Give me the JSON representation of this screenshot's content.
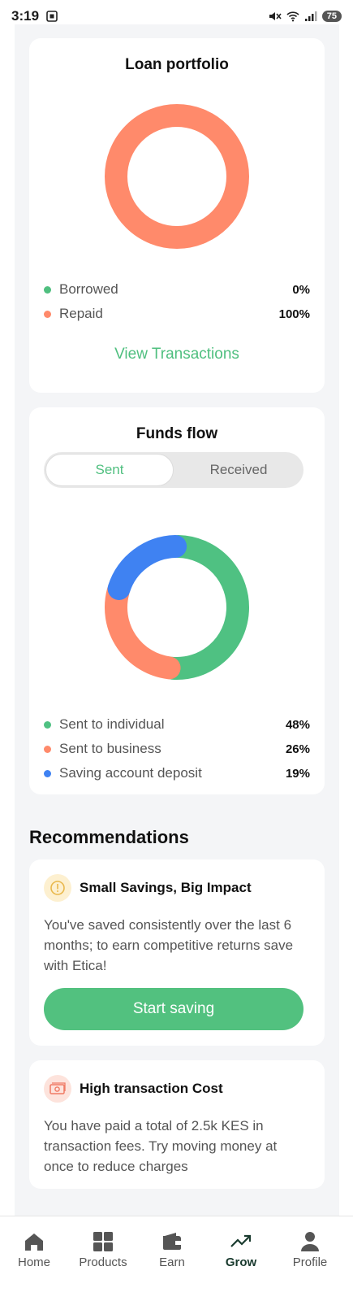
{
  "status_bar": {
    "time": "3:19",
    "battery": "75"
  },
  "loan_portfolio": {
    "title": "Loan portfolio",
    "legend": [
      {
        "label": "Borrowed",
        "value": "0%",
        "color": "#4fbf7f"
      },
      {
        "label": "Repaid",
        "value": "100%",
        "color": "#ff8a6b"
      }
    ],
    "link": "View Transactions"
  },
  "funds_flow": {
    "title": "Funds flow",
    "tabs": {
      "sent": "Sent",
      "received": "Received"
    },
    "legend": [
      {
        "label": "Sent to individual",
        "value": "48%",
        "color": "#4fc182"
      },
      {
        "label": "Sent to business",
        "value": "26%",
        "color": "#ff8a6b"
      },
      {
        "label": "Saving account deposit",
        "value": "19%",
        "color": "#3f82f2"
      }
    ]
  },
  "recommendations": {
    "heading": "Recommendations",
    "items": [
      {
        "title": "Small Savings, Big Impact",
        "body": "You've saved consistently over the last 6 months; to earn competitive returns save with Etica!",
        "button": "Start saving",
        "icon": "warning-circle-icon"
      },
      {
        "title": "High transaction Cost",
        "body": "You have paid a total of 2.5k KES in transaction fees. Try moving money at once to reduce charges",
        "icon": "cash-icon"
      }
    ]
  },
  "bottom_nav": {
    "items": [
      {
        "label": "Home",
        "icon": "home-icon"
      },
      {
        "label": "Products",
        "icon": "grid-icon"
      },
      {
        "label": "Earn",
        "icon": "wallet-icon"
      },
      {
        "label": "Grow",
        "icon": "trend-up-icon",
        "active": true
      },
      {
        "label": "Profile",
        "icon": "person-icon"
      }
    ]
  },
  "chart_data": [
    {
      "type": "pie",
      "title": "Loan portfolio",
      "categories": [
        "Borrowed",
        "Repaid"
      ],
      "values": [
        0,
        100
      ]
    },
    {
      "type": "pie",
      "title": "Funds flow",
      "categories": [
        "Sent to individual",
        "Sent to business",
        "Saving account deposit"
      ],
      "values": [
        48,
        26,
        19
      ]
    }
  ]
}
